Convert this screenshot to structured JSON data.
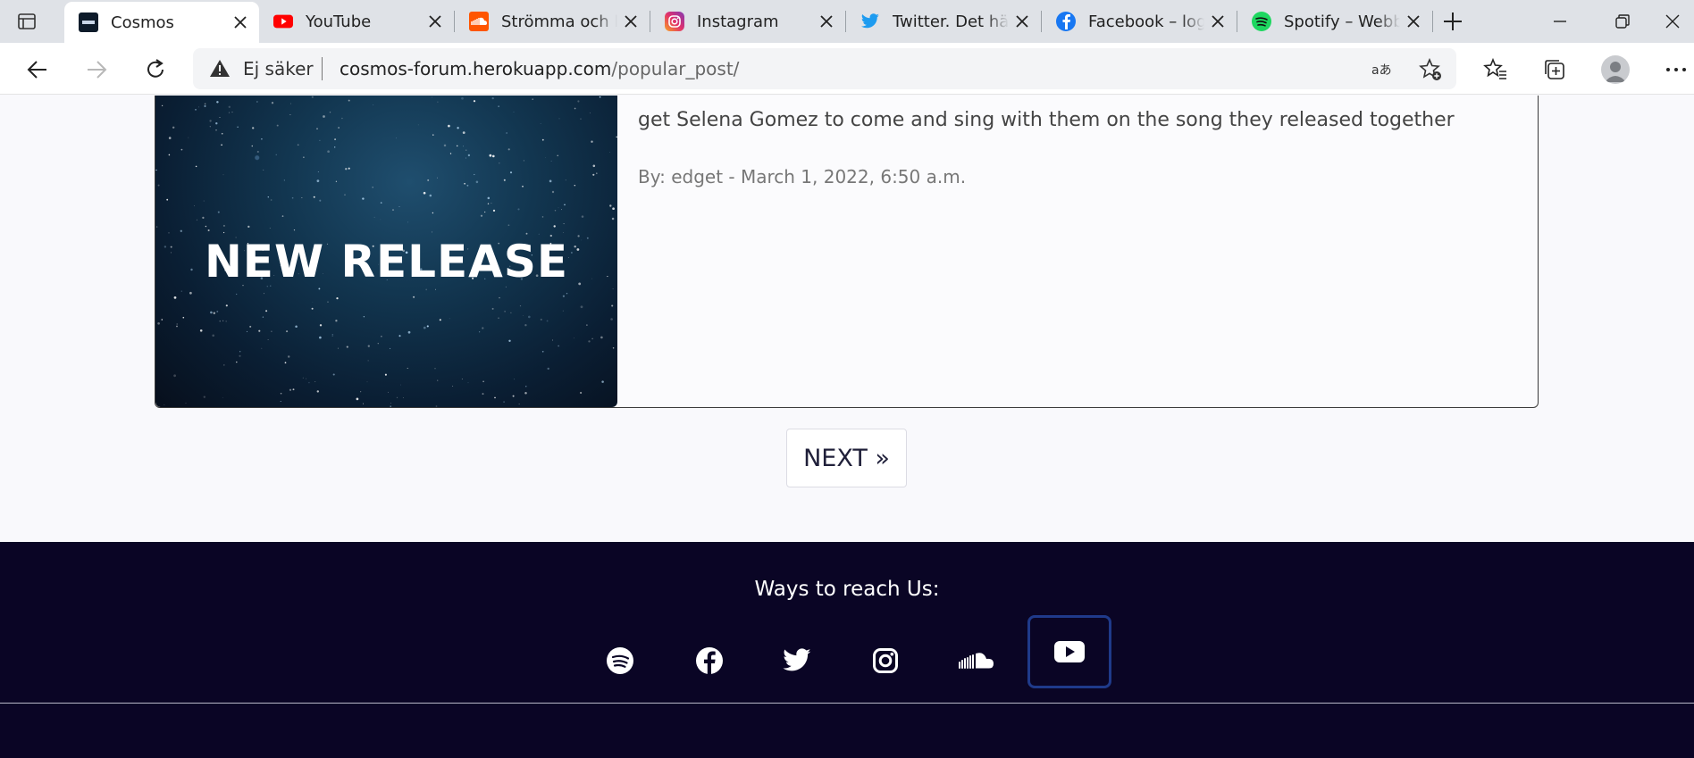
{
  "tabs": [
    {
      "title": "Cosmos",
      "icon": "cosmos-favicon",
      "active": true
    },
    {
      "title": "YouTube",
      "icon": "youtube-favicon"
    },
    {
      "title": "Strömma och lyssna",
      "icon": "soundcloud-favicon"
    },
    {
      "title": "Instagram",
      "icon": "instagram-favicon"
    },
    {
      "title": "Twitter. Det här händer",
      "icon": "twitter-favicon"
    },
    {
      "title": "Facebook – logga in",
      "icon": "facebook-favicon"
    },
    {
      "title": "Spotify – Webbspelare",
      "icon": "spotify-favicon"
    }
  ],
  "toolbar": {
    "security_label": "Ej säker",
    "url_host": "cosmos-forum.herokuapp.com",
    "url_path": "/popular_post/"
  },
  "post": {
    "image_text": "NEW RELEASE",
    "excerpt": "get Selena Gomez to come and sing with them on the song they released together",
    "meta": "By: edget - March 1, 2022, 6:50 a.m."
  },
  "pagination": {
    "next_label": "NEXT »"
  },
  "footer": {
    "title": "Ways to reach Us:",
    "social": [
      "spotify",
      "facebook",
      "twitter",
      "instagram",
      "soundcloud",
      "youtube"
    ]
  },
  "colors": {
    "footer_bg": "#0a0525",
    "focus_ring": "#1f3a8a",
    "page_bg": "#f9f9fc"
  }
}
